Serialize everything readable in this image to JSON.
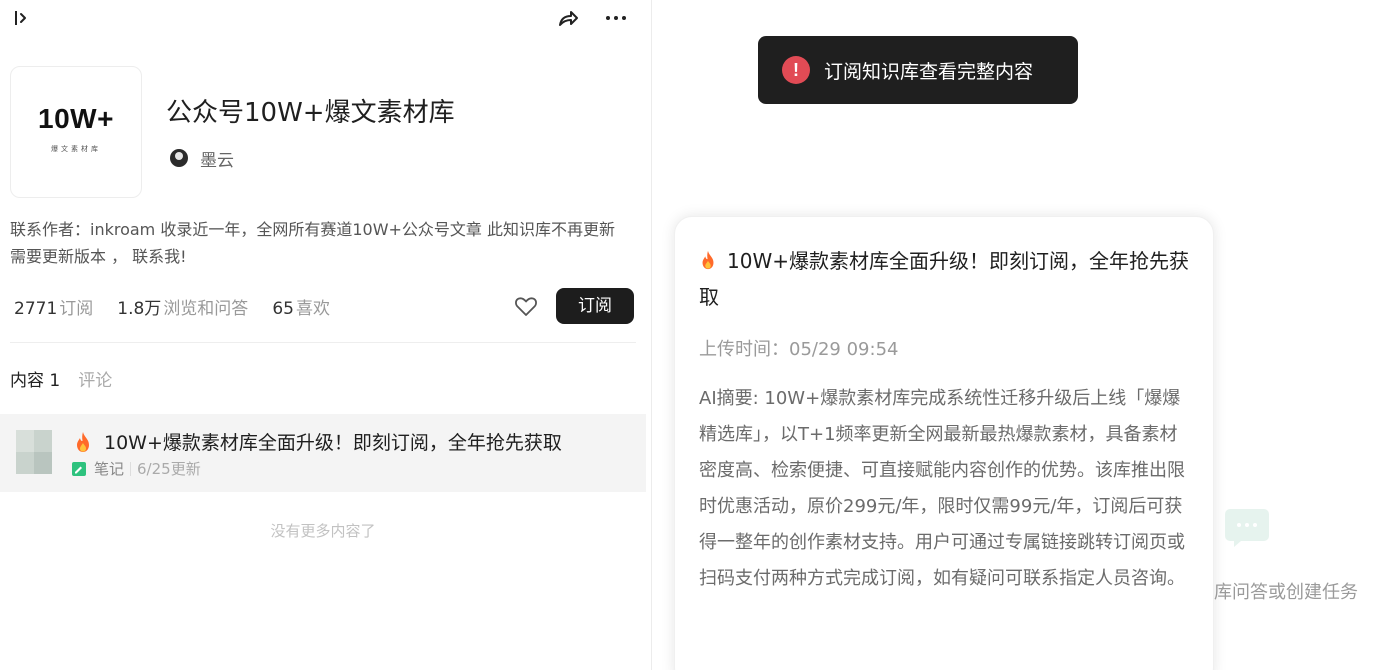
{
  "topbar": {
    "collapse_icon": "sidebar-expand-icon",
    "share_icon": "share-icon",
    "more_icon": "more-icon"
  },
  "cover": {
    "title": "10W+",
    "subtitle": "爆文素材库"
  },
  "knowledge_base": {
    "title": "公众号10W+爆文素材库",
    "author": "墨云",
    "description": "联系作者：inkroam 收录近一年，全网所有赛道10W+公众号文章 此知识库不再更新 需要更新版本 ， 联系我!"
  },
  "stats": [
    {
      "value": "2771",
      "label": "订阅"
    },
    {
      "value": "1.8万",
      "label": "浏览和问答"
    },
    {
      "value": "65",
      "label": "喜欢"
    }
  ],
  "actions": {
    "subscribe_label": "订阅",
    "like_icon": "heart-icon"
  },
  "tabs": [
    {
      "label": "内容 1"
    },
    {
      "label": "评论"
    }
  ],
  "content_list": [
    {
      "title": "10W+爆款素材库全面升级！即刻订阅，全年抢先获取",
      "type": "笔记",
      "updated": "6/25更新"
    }
  ],
  "no_more_text": "没有更多内容了",
  "toast": {
    "text": "订阅知识库查看完整内容",
    "icon_text": "!"
  },
  "detail_card": {
    "title": "10W+爆款素材库全面升级！即刻订阅，全年抢先获取",
    "upload_time": "上传时间：05/29 09:54",
    "summary": "AI摘要: 10W+爆款素材库完成系统性迁移升级后上线「爆爆精选库」，以T+1频率更新全网最新最热爆款素材，具备素材密度高、检索便捷、可直接赋能内容创作的优势。该库推出限时优惠活动，原价299元/年，限时仅需99元/年，订阅后可获得一整年的创作素材支持。用户可通过专属链接跳转订阅页或扫码支付两种方式完成订阅，如有疑问可联系指定人员咨询。"
  },
  "empty_hint": {
    "text": "库问答或创建任务",
    "icon": "chat-bubble-icon"
  },
  "colors": {
    "toast_bg": "#1f1f1f",
    "alert_red": "#e14b55",
    "primary_button": "#1d1d1d",
    "note_green": "#2ec27e"
  }
}
